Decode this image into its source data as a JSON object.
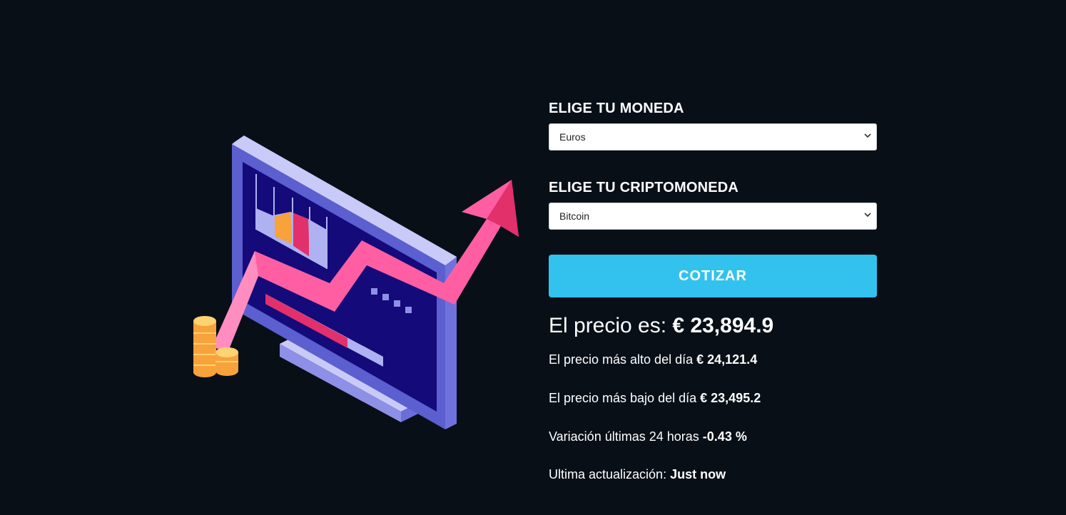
{
  "form": {
    "currency_label": "ELIGE TU MONEDA",
    "currency_value": "Euros",
    "crypto_label": "ELIGE TU CRIPTOMONEDA",
    "crypto_value": "Bitcoin",
    "submit_label": "COTIZAR"
  },
  "result": {
    "price_label": "El precio es:",
    "price_value": "€ 23,894.9",
    "high_label": "El precio más alto del día",
    "high_value": "€ 24,121.4",
    "low_label": "El precio más bajo del día",
    "low_value": "€ 23,495.2",
    "change_label": "Variación últimas 24 horas",
    "change_value": "-0.43 %",
    "updated_label": "Ultima actualización:",
    "updated_value": "Just now"
  },
  "colors": {
    "background": "#080f17",
    "button": "#33c2ee",
    "arrow": "#ff5fa2",
    "monitor": "#5b5fd0",
    "screen": "#140a7a",
    "coins": "#f9b94a"
  },
  "icons": {
    "select_chevron": "chevron-down-icon",
    "illustration": "crypto-growth-illustration"
  }
}
